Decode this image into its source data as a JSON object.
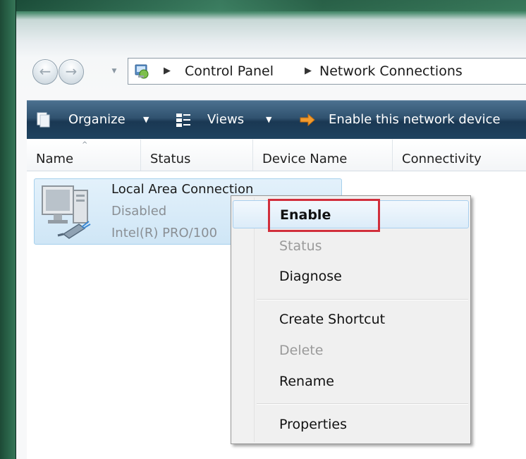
{
  "address": {
    "crumbs": [
      "Control Panel",
      "Network Connections"
    ],
    "icon": "control-panel-icon"
  },
  "navigation": {
    "back_icon": "back-arrow-icon",
    "forward_icon": "forward-arrow-icon",
    "recent_icon": "chevron-down-icon"
  },
  "command_bar": {
    "organize": "Organize",
    "views": "Views",
    "enable_device": "Enable this network device"
  },
  "columns": [
    "Name",
    "Status",
    "Device Name",
    "Connectivity"
  ],
  "connection": {
    "name": "Local Area Connection",
    "status": "Disabled",
    "device": "Intel(R) PRO/100"
  },
  "context_menu": {
    "items": [
      {
        "label": "Enable",
        "bold": true,
        "disabled": false
      },
      {
        "label": "Status",
        "bold": false,
        "disabled": true
      },
      {
        "label": "Diagnose",
        "bold": false,
        "disabled": false
      },
      {
        "label": "Create Shortcut",
        "bold": false,
        "disabled": false
      },
      {
        "label": "Delete",
        "bold": false,
        "disabled": true
      },
      {
        "label": "Rename",
        "bold": false,
        "disabled": false
      },
      {
        "label": "Properties",
        "bold": false,
        "disabled": false
      }
    ]
  },
  "colors": {
    "command_bar": "#1f4360",
    "highlight": "#d12f3c",
    "selection": "#cfe6f6"
  }
}
